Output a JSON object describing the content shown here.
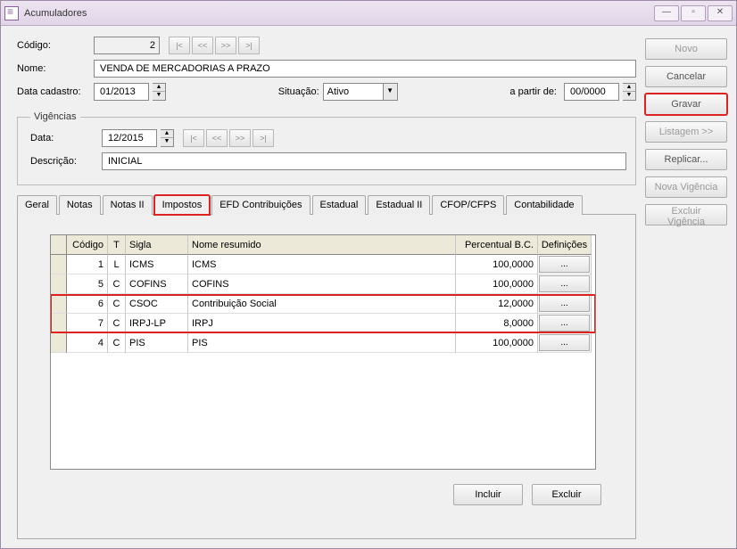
{
  "window": {
    "title": "Acumuladores"
  },
  "labels": {
    "codigo": "Código:",
    "nome": "Nome:",
    "data_cadastro": "Data cadastro:",
    "situacao": "Situação:",
    "a_partir_de": "a partir de:",
    "vigencias_legend": "Vigências",
    "data": "Data:",
    "descricao": "Descrição:"
  },
  "values": {
    "codigo": "2",
    "nome": "VENDA DE MERCADORIAS A PRAZO",
    "data_cadastro": "01/2013",
    "situacao": "Ativo",
    "a_partir_de": "00/0000",
    "vig_data": "12/2015",
    "descricao": "INICIAL"
  },
  "nav": {
    "first": "|<",
    "prev": "<<",
    "next": ">>",
    "last": ">|"
  },
  "tabs": [
    "Geral",
    "Notas",
    "Notas II",
    "Impostos",
    "EFD Contribuições",
    "Estadual",
    "Estadual II",
    "CFOP/CFPS",
    "Contabilidade"
  ],
  "active_tab": "Impostos",
  "grid": {
    "headers": {
      "codigo": "Código",
      "t": "T",
      "sigla": "Sigla",
      "nome": "Nome resumido",
      "perc": "Percentual B.C.",
      "def": "Definições"
    },
    "def_btn": "...",
    "rows": [
      {
        "codigo": "1",
        "t": "L",
        "sigla": "ICMS",
        "nome": "ICMS",
        "perc": "100,0000"
      },
      {
        "codigo": "5",
        "t": "C",
        "sigla": "COFINS",
        "nome": "COFINS",
        "perc": "100,0000"
      },
      {
        "codigo": "6",
        "t": "C",
        "sigla": "CSOC",
        "nome": "Contribuição Social",
        "perc": "12,0000"
      },
      {
        "codigo": "7",
        "t": "C",
        "sigla": "IRPJ-LP",
        "nome": "IRPJ",
        "perc": "8,0000"
      },
      {
        "codigo": "4",
        "t": "C",
        "sigla": "PIS",
        "nome": "PIS",
        "perc": "100,0000"
      }
    ]
  },
  "panel_buttons": {
    "incluir": "Incluir",
    "excluir": "Excluir"
  },
  "side_buttons": {
    "novo": "Novo",
    "cancelar": "Cancelar",
    "gravar": "Gravar",
    "listagem": "Listagem >>",
    "replicar": "Replicar...",
    "nova_vig": "Nova Vigência",
    "excluir_vig": "Excluir Vigência"
  }
}
